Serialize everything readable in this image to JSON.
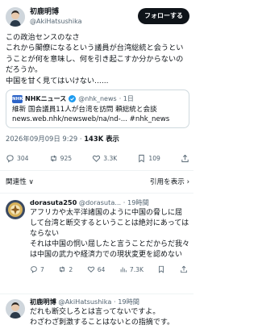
{
  "post": {
    "author_name": "初鹿明博",
    "author_handle": "@AkiHatsushika",
    "follow_label": "フォローする",
    "text": "この政治センスのなさ\nこれから閣僚になるという議員が台湾総統と会うということが何を意味し、何を引き起こすか分からないのだろうか。\n中国を甘く見てはいけない......",
    "timestamp": "2026年09月09日 9:29 · ",
    "views": "143K 表示"
  },
  "quote": {
    "logo_text": "NHK",
    "name": "NHKニュース",
    "handle": "@nhk_news",
    "age": "· 1日",
    "text": "維新 国会議員11人が台湾を訪問 頼総統と会談\nnews.web.nhk/newsweb/na/nd-... #nhk_news"
  },
  "actions": {
    "replies": "304",
    "retweets": "925",
    "likes": "3.3K",
    "bookmarks": "109"
  },
  "replies_bar": {
    "sort_label": "関連性",
    "sort_caret": "∨",
    "quotes_label": "引用を表示",
    "quotes_arrow": "›"
  },
  "replies": [
    {
      "name": "dorasuta250",
      "handle": "@dorasuta...",
      "age": "· 19時間",
      "text": "アフリカや太平洋諸国のように中国の脅しに屈して台湾と断交するということは絶対にあってはならない\nそれは中国の恫い屈したと言うことだからだ我々は中国の武力や経済力での現状変更を認めない",
      "replies": "7",
      "retweets": "2",
      "likes": "64",
      "views": "7.3K"
    },
    {
      "name": "初鹿明博",
      "handle": "@AkiHatsushika",
      "age": "· 19時間",
      "text": "だれも断交しろとは言ってないですよ。\nわざわざ刺激することはないとの指摘です。"
    }
  ],
  "colors": {
    "text": "#0f1419",
    "muted": "#536471",
    "border": "#cfd9de",
    "verified": "#1d9bf0",
    "nhk": "#2e65c8"
  },
  "icons": {
    "reply": "speech-bubble-icon",
    "retweet": "retweet-arrows-icon",
    "like": "heart-icon",
    "views": "bar-chart-icon",
    "bookmark": "bookmark-icon",
    "share": "share-icon",
    "more": "more-dots-icon"
  }
}
